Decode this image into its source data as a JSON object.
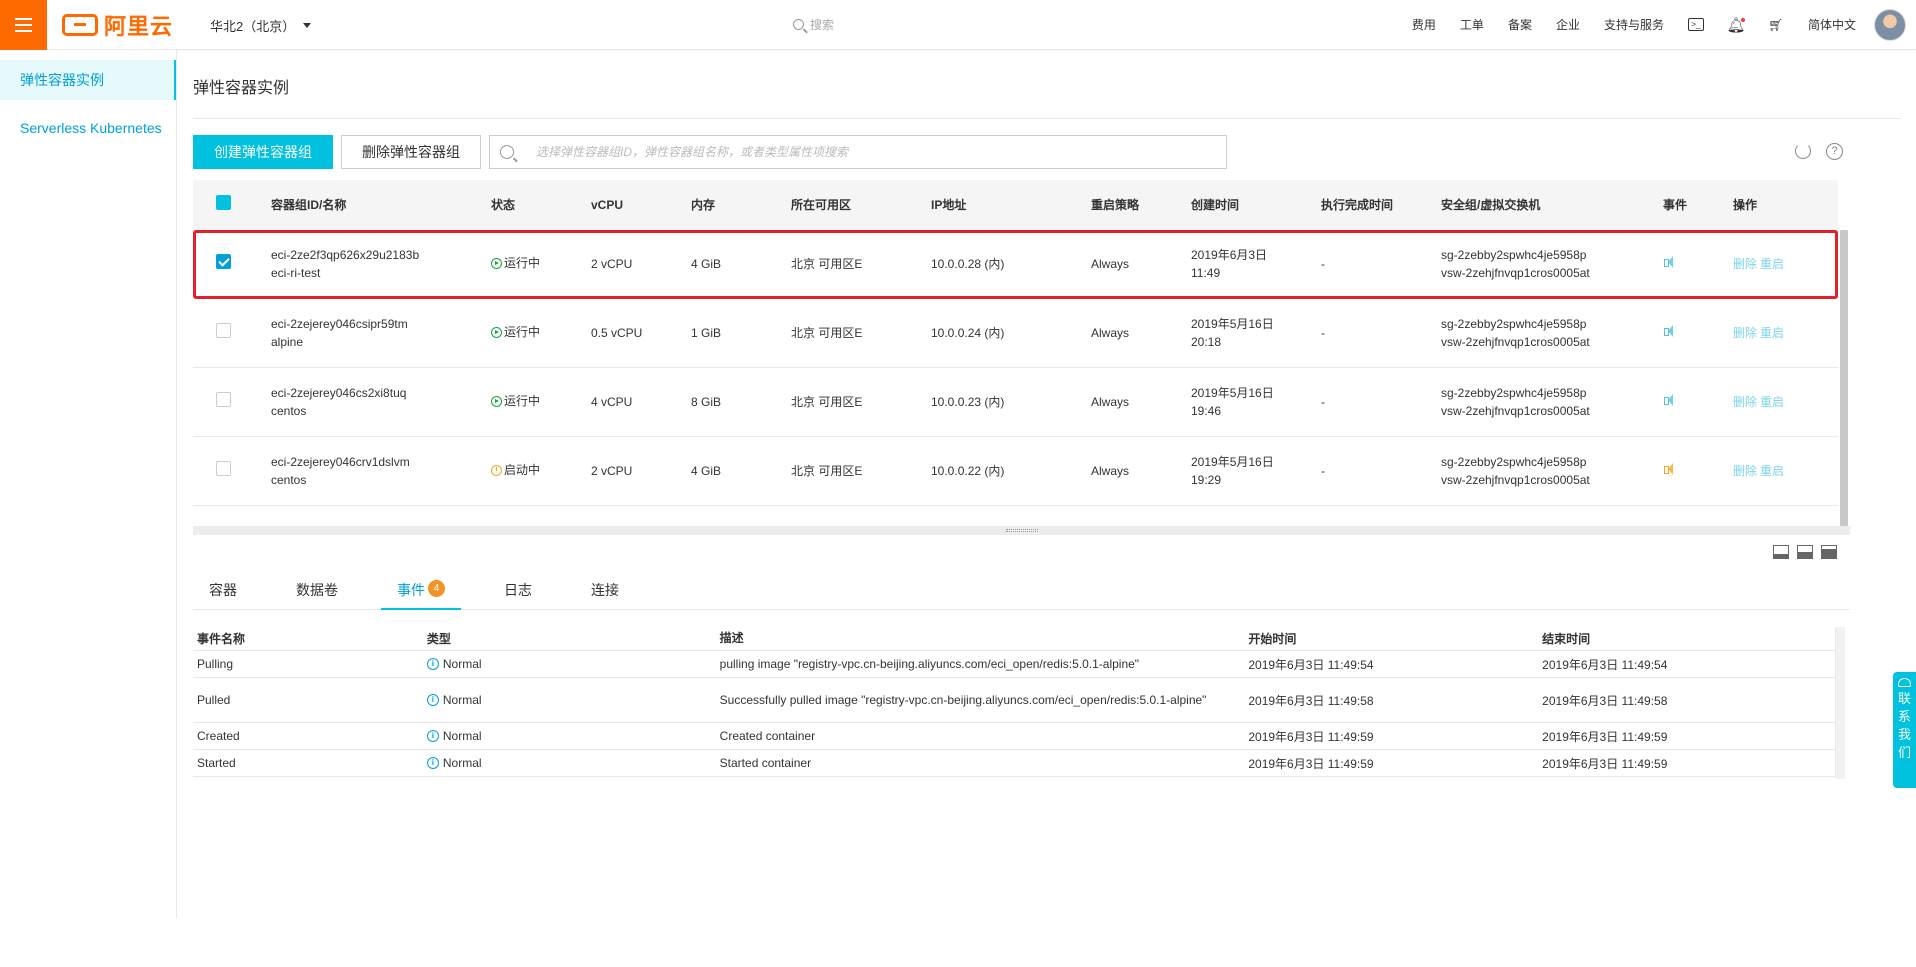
{
  "header": {
    "brand": "阿里云",
    "region": "华北2（北京）",
    "search_placeholder": "搜索",
    "nav": [
      "费用",
      "工单",
      "备案",
      "企业",
      "支持与服务"
    ],
    "language": "简体中文"
  },
  "sidebar": {
    "items": [
      {
        "label": "弹性容器实例",
        "active": true
      },
      {
        "label": "Serverless Kubernetes",
        "active": false
      }
    ]
  },
  "main": {
    "title": "弹性容器实例",
    "create_button": "创建弹性容器组",
    "delete_button": "删除弹性容器组",
    "search_placeholder": "选择弹性容器组ID，弹性容器组名称，或者类型属性项搜索"
  },
  "table": {
    "columns": [
      "容器组ID/名称",
      "状态",
      "vCPU",
      "内存",
      "所在可用区",
      "IP地址",
      "重启策略",
      "创建时间",
      "执行完成时间",
      "安全组/虚拟交换机",
      "事件",
      "操作"
    ],
    "rows": [
      {
        "id": "eci-2ze2f3qp626x29u2183b",
        "name": "eci-ri-test",
        "status": "运行中",
        "status_kind": "running",
        "vcpu": "2 vCPU",
        "memory": "4 GiB",
        "zone": "北京 可用区E",
        "ip": "10.0.0.28 (内)",
        "restart": "Always",
        "created_date": "2019年6月3日",
        "created_time": "11:49",
        "finished": "-",
        "sg": "sg-2zebby2spwhc4je5958p",
        "vsw": "vsw-2zehjfnvqp1cros0005at",
        "event_color": "#4fc3e0",
        "op_delete": "删除",
        "op_restart": "重启",
        "checked": true
      },
      {
        "id": "eci-2zejerey046csipr59tm",
        "name": "alpine",
        "status": "运行中",
        "status_kind": "running",
        "vcpu": "0.5 vCPU",
        "memory": "1 GiB",
        "zone": "北京 可用区E",
        "ip": "10.0.0.24 (内)",
        "restart": "Always",
        "created_date": "2019年5月16日",
        "created_time": "20:18",
        "finished": "-",
        "sg": "sg-2zebby2spwhc4je5958p",
        "vsw": "vsw-2zehjfnvqp1cros0005at",
        "event_color": "#4fc3e0",
        "op_delete": "删除",
        "op_restart": "重启",
        "checked": false
      },
      {
        "id": "eci-2zejerey046cs2xi8tuq",
        "name": "centos",
        "status": "运行中",
        "status_kind": "running",
        "vcpu": "4 vCPU",
        "memory": "8 GiB",
        "zone": "北京 可用区E",
        "ip": "10.0.0.23 (内)",
        "restart": "Always",
        "created_date": "2019年5月16日",
        "created_time": "19:46",
        "finished": "-",
        "sg": "sg-2zebby2spwhc4je5958p",
        "vsw": "vsw-2zehjfnvqp1cros0005at",
        "event_color": "#4fc3e0",
        "op_delete": "删除",
        "op_restart": "重启",
        "checked": false
      },
      {
        "id": "eci-2zejerey046crv1dslvm",
        "name": "centos",
        "status": "启动中",
        "status_kind": "starting",
        "vcpu": "2 vCPU",
        "memory": "4 GiB",
        "zone": "北京 可用区E",
        "ip": "10.0.0.22 (内)",
        "restart": "Always",
        "created_date": "2019年5月16日",
        "created_time": "19:29",
        "finished": "-",
        "sg": "sg-2zebby2spwhc4je5958p",
        "vsw": "vsw-2zehjfnvqp1cros0005at",
        "event_color": "#f5a623",
        "op_delete": "删除",
        "op_restart": "重启",
        "checked": false
      }
    ]
  },
  "tabs": [
    {
      "label": "容器",
      "active": false
    },
    {
      "label": "数据卷",
      "active": false
    },
    {
      "label": "事件",
      "active": true,
      "badge": "4"
    },
    {
      "label": "日志",
      "active": false
    },
    {
      "label": "连接",
      "active": false
    }
  ],
  "events": {
    "columns": [
      "事件名称",
      "类型",
      "描述",
      "开始时间",
      "结束时间"
    ],
    "rows": [
      {
        "name": "Pulling",
        "type": "Normal",
        "desc": "pulling image \"registry-vpc.cn-beijing.aliyuncs.com/eci_open/redis:5.0.1-alpine\"",
        "start": "2019年6月3日 11:49:54",
        "end": "2019年6月3日 11:49:54"
      },
      {
        "name": "Pulled",
        "type": "Normal",
        "desc": "Successfully pulled image \"registry-vpc.cn-beijing.aliyuncs.com/eci_open/redis:5.0.1-alpine\"",
        "start": "2019年6月3日 11:49:58",
        "end": "2019年6月3日 11:49:58"
      },
      {
        "name": "Created",
        "type": "Normal",
        "desc": "Created container",
        "start": "2019年6月3日 11:49:59",
        "end": "2019年6月3日 11:49:59"
      },
      {
        "name": "Started",
        "type": "Normal",
        "desc": "Started container",
        "start": "2019年6月3日 11:49:59",
        "end": "2019年6月3日 11:49:59"
      }
    ]
  },
  "contact": "联系我们",
  "colors": {
    "brand": "#ff6a00",
    "accent": "#00c1de",
    "link": "#00a1d6",
    "highlight": "#e0202a"
  }
}
